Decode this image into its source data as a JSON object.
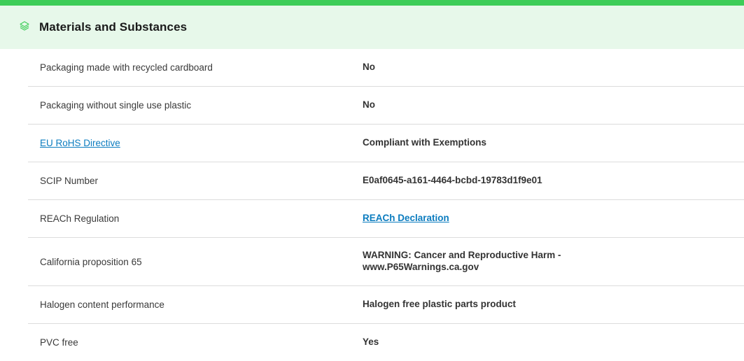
{
  "section": {
    "title": "Materials and Substances",
    "icon": "layers-icon",
    "accent_color": "#3dcd58",
    "header_bg": "#e7f8ea",
    "link_color": "#0b7cbf"
  },
  "rows": [
    {
      "label": "Packaging made with recycled cardboard",
      "value": "No"
    },
    {
      "label": "Packaging without single use plastic",
      "value": "No"
    },
    {
      "label": "EU RoHS Directive",
      "value": "Compliant with Exemptions"
    },
    {
      "label": "SCIP Number",
      "value": "E0af0645-a161-4464-bcbd-19783d1f9e01"
    },
    {
      "label": "REACh Regulation",
      "value": "REACh Declaration"
    },
    {
      "label": "California proposition 65",
      "value_line1": "WARNING: Cancer and Reproductive Harm -",
      "value_line2": "www.P65Warnings.ca.gov"
    },
    {
      "label": "Halogen content performance",
      "value": "Halogen free plastic parts product"
    },
    {
      "label": "PVC free",
      "value": "Yes"
    }
  ]
}
